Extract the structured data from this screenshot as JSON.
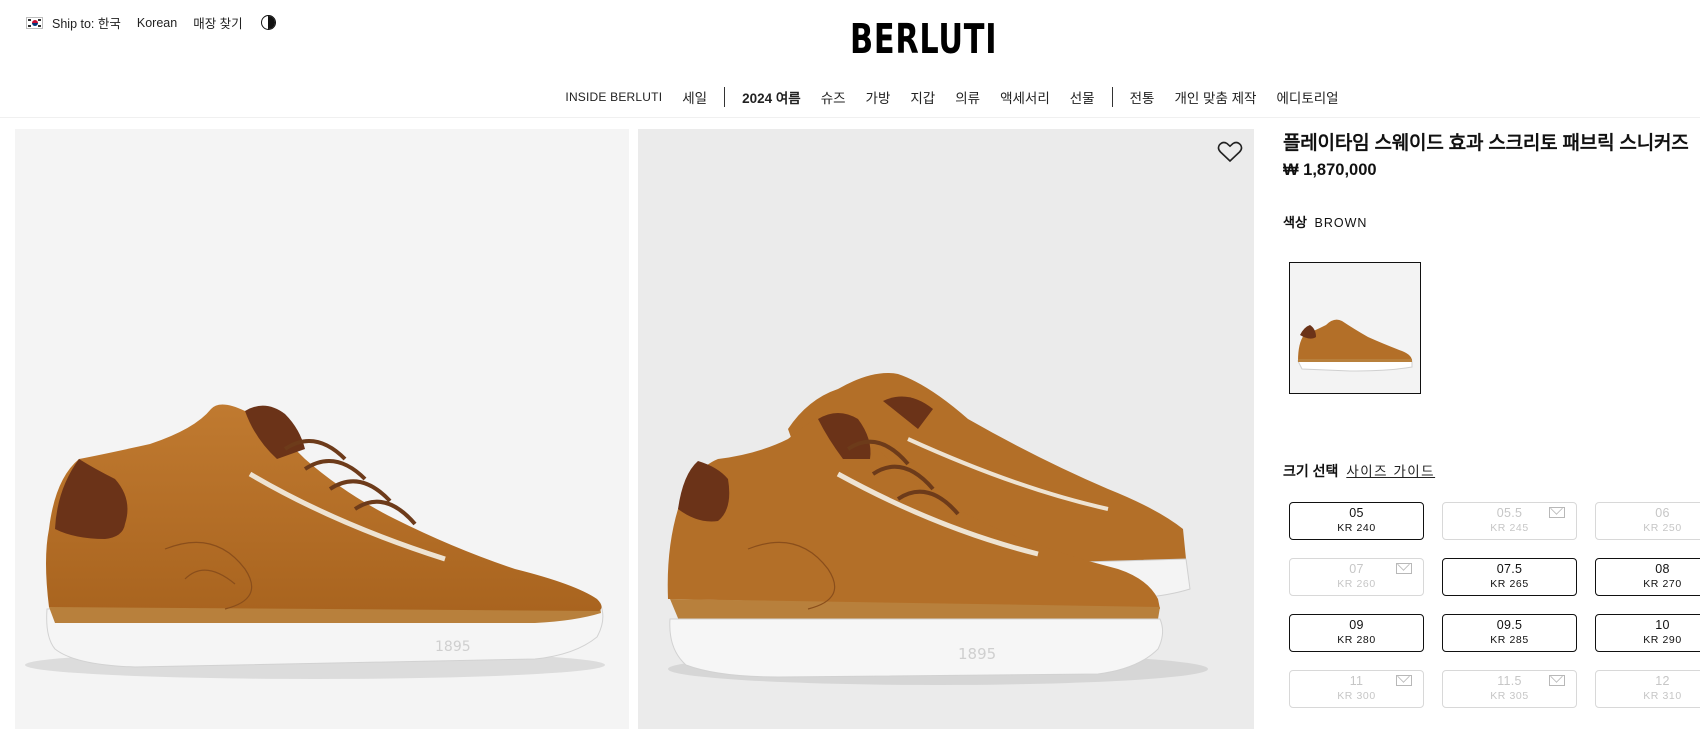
{
  "header": {
    "ship_to": "Ship to: 한국",
    "language": "Korean",
    "store_finder": "매장 찾기",
    "logo": "BERLUTI"
  },
  "nav": {
    "items": [
      "INSIDE BERLUTI",
      "세일",
      "2024 여름",
      "슈즈",
      "가방",
      "지갑",
      "의류",
      "액세서리",
      "선물",
      "전통",
      "개인 맞춤 제작",
      "에디토리얼"
    ]
  },
  "product": {
    "title": "플레이타임 스웨이드 효과 스크리토 패브릭 스니커즈",
    "price": "₩ 1,870,000",
    "color_label": "색상",
    "color_value": "BROWN",
    "size_label": "크기 선택",
    "size_guide": "사이즈 가이드"
  },
  "sizes": [
    {
      "size": "05",
      "kr": "KR 240",
      "available": true
    },
    {
      "size": "05.5",
      "kr": "KR 245",
      "available": false
    },
    {
      "size": "06",
      "kr": "KR 250",
      "available": false
    },
    {
      "size": "07",
      "kr": "KR 260",
      "available": false
    },
    {
      "size": "07.5",
      "kr": "KR 265",
      "available": true
    },
    {
      "size": "08",
      "kr": "KR 270",
      "available": true
    },
    {
      "size": "09",
      "kr": "KR 280",
      "available": true
    },
    {
      "size": "09.5",
      "kr": "KR 285",
      "available": true
    },
    {
      "size": "10",
      "kr": "KR 290",
      "available": true
    },
    {
      "size": "11",
      "kr": "KR 300",
      "available": false
    },
    {
      "size": "11.5",
      "kr": "KR 305",
      "available": false
    },
    {
      "size": "12",
      "kr": "KR 310",
      "available": false
    }
  ],
  "theme": {
    "suede": "#b26c27",
    "leather": "#6b3318",
    "sole": "#f2f2f2"
  },
  "icons": {
    "flag": "korea-flag-icon",
    "contrast": "contrast-icon",
    "wishlist": "heart-icon",
    "notify": "mail-icon"
  }
}
